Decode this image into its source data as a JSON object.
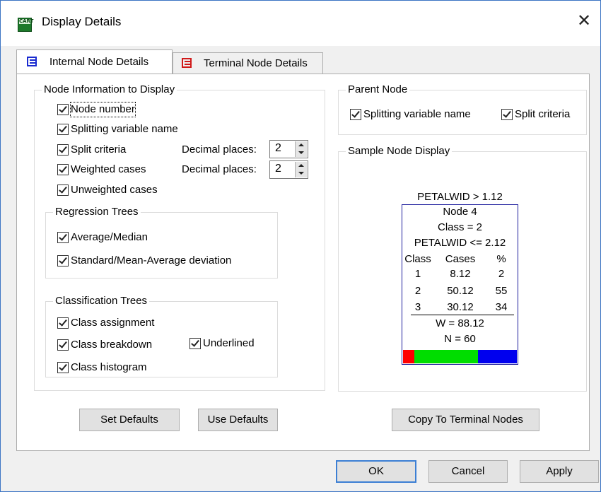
{
  "window": {
    "title": "Display Details",
    "icon_label": "CART"
  },
  "tabs": [
    {
      "label": "Internal Node Details",
      "color": "#1a2bd0",
      "active": true
    },
    {
      "label": "Terminal Node Details",
      "color": "#d01a1a",
      "active": false
    }
  ],
  "node_info": {
    "title": "Node Information to Display",
    "node_number": "Node number",
    "splitting_variable": "Splitting variable name",
    "split_criteria": "Split criteria",
    "weighted_cases": "Weighted cases",
    "unweighted_cases": "Unweighted cases",
    "decimal_label_1": "Decimal places:",
    "decimal_value_1": "2",
    "decimal_label_2": "Decimal places:",
    "decimal_value_2": "2"
  },
  "regression": {
    "title": "Regression Trees",
    "average_median": "Average/Median",
    "std_dev": "Standard/Mean-Average deviation"
  },
  "classification": {
    "title": "Classification Trees",
    "class_assignment": "Class assignment",
    "class_breakdown": "Class breakdown",
    "underlined": "Underlined",
    "class_histogram": "Class histogram"
  },
  "parent_node": {
    "title": "Parent Node",
    "splitting_variable": "Splitting variable name",
    "split_criteria": "Split criteria"
  },
  "sample": {
    "title": "Sample Node Display",
    "split_above": "PETALWID > 1.12",
    "node": "Node 4",
    "class": "Class = 2",
    "split_inside": "PETALWID <= 2.12",
    "headers": [
      "Class",
      "Cases",
      "%"
    ],
    "rows": [
      [
        "1",
        "8.12",
        "2"
      ],
      [
        "2",
        "50.12",
        "55"
      ],
      [
        "3",
        "30.12",
        "34"
      ]
    ],
    "weight": "W = 88.12",
    "count": "N = 60",
    "histogram": [
      {
        "fraction": 0.1,
        "color": "#ff0000"
      },
      {
        "fraction": 0.56,
        "color": "#00dd00"
      },
      {
        "fraction": 0.34,
        "color": "#0000ee"
      }
    ]
  },
  "buttons": {
    "set_defaults": "Set Defaults",
    "use_defaults": "Use Defaults",
    "copy_to_terminal": "Copy To Terminal Nodes",
    "ok": "OK",
    "cancel": "Cancel",
    "apply": "Apply"
  }
}
